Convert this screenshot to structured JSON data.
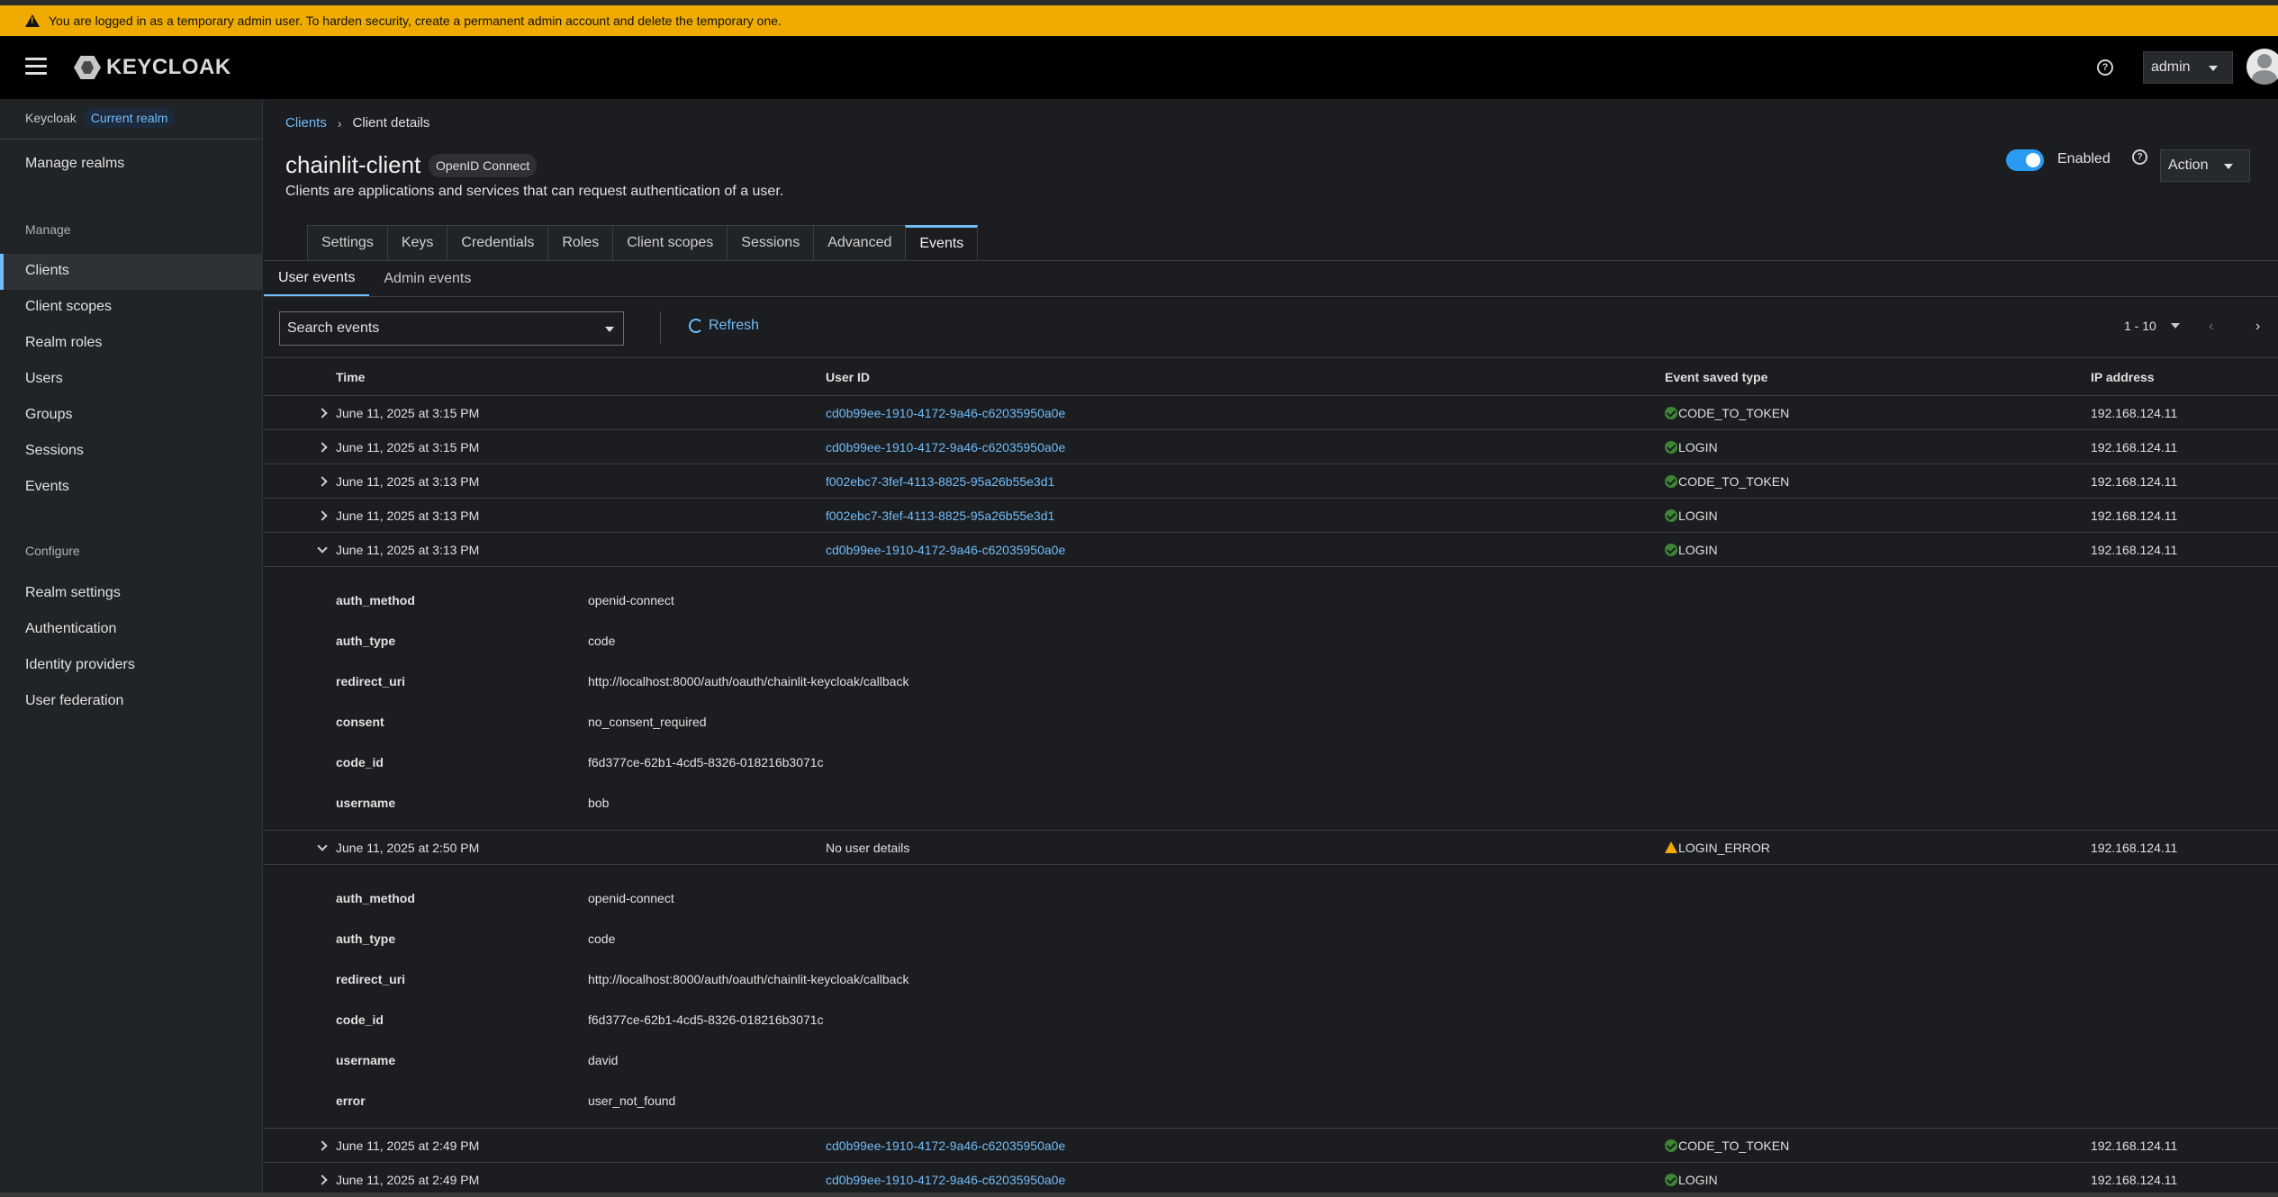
{
  "banner": {
    "text": "You are logged in as a temporary admin user. To harden security, create a permanent admin account and delete the temporary one."
  },
  "masthead": {
    "logo_text": "KEYCLOAK",
    "user": "admin"
  },
  "sidebar": {
    "realm_label": "Keycloak",
    "realm_badge": "Current realm",
    "manage_realms": "Manage realms",
    "manage_section": "Manage",
    "manage_items": [
      "Clients",
      "Client scopes",
      "Realm roles",
      "Users",
      "Groups",
      "Sessions",
      "Events"
    ],
    "configure_section": "Configure",
    "configure_items": [
      "Realm settings",
      "Authentication",
      "Identity providers",
      "User federation"
    ]
  },
  "breadcrumb": {
    "parent": "Clients",
    "current": "Client details"
  },
  "client": {
    "name": "chainlit-client",
    "protocol": "OpenID Connect",
    "description": "Clients are applications and services that can request authentication of a user.",
    "enabled_label": "Enabled",
    "action_label": "Action"
  },
  "tabs": [
    "Settings",
    "Keys",
    "Credentials",
    "Roles",
    "Client scopes",
    "Sessions",
    "Advanced",
    "Events"
  ],
  "active_tab": "Events",
  "subtabs": [
    "User events",
    "Admin events"
  ],
  "toolbar": {
    "search_placeholder": "Search events",
    "refresh_label": "Refresh",
    "pagination": "1 - 10"
  },
  "table": {
    "headers": {
      "time": "Time",
      "user_id": "User ID",
      "event_type": "Event saved type",
      "ip": "IP address"
    },
    "rows": [
      {
        "time": "June 11, 2025 at 3:15 PM",
        "user_id": "cd0b99ee-1910-4172-9a46-c62035950a0e",
        "type": "CODE_TO_TOKEN",
        "ip": "192.168.124.11"
      },
      {
        "time": "June 11, 2025 at 3:15 PM",
        "user_id": "cd0b99ee-1910-4172-9a46-c62035950a0e",
        "type": "LOGIN",
        "ip": "192.168.124.11"
      },
      {
        "time": "June 11, 2025 at 3:13 PM",
        "user_id": "f002ebc7-3fef-4113-8825-95a26b55e3d1",
        "type": "CODE_TO_TOKEN",
        "ip": "192.168.124.11"
      },
      {
        "time": "June 11, 2025 at 3:13 PM",
        "user_id": "f002ebc7-3fef-4113-8825-95a26b55e3d1",
        "type": "LOGIN",
        "ip": "192.168.124.11"
      },
      {
        "time": "June 11, 2025 at 3:13 PM",
        "user_id": "cd0b99ee-1910-4172-9a46-c62035950a0e",
        "type": "LOGIN",
        "ip": "192.168.124.11"
      },
      {
        "time": "June 11, 2025 at 2:50 PM",
        "user_id": "No user details",
        "type": "LOGIN_ERROR",
        "ip": "192.168.124.11"
      },
      {
        "time": "June 11, 2025 at 2:49 PM",
        "user_id": "cd0b99ee-1910-4172-9a46-c62035950a0e",
        "type": "CODE_TO_TOKEN",
        "ip": "192.168.124.11"
      },
      {
        "time": "June 11, 2025 at 2:49 PM",
        "user_id": "cd0b99ee-1910-4172-9a46-c62035950a0e",
        "type": "LOGIN",
        "ip": "192.168.124.11"
      }
    ],
    "details_1": [
      {
        "key": "auth_method",
        "value": "openid-connect"
      },
      {
        "key": "auth_type",
        "value": "code"
      },
      {
        "key": "redirect_uri",
        "value": "http://localhost:8000/auth/oauth/chainlit-keycloak/callback"
      },
      {
        "key": "consent",
        "value": "no_consent_required"
      },
      {
        "key": "code_id",
        "value": "f6d377ce-62b1-4cd5-8326-018216b3071c"
      },
      {
        "key": "username",
        "value": "bob"
      }
    ],
    "details_2": [
      {
        "key": "auth_method",
        "value": "openid-connect"
      },
      {
        "key": "auth_type",
        "value": "code"
      },
      {
        "key": "redirect_uri",
        "value": "http://localhost:8000/auth/oauth/chainlit-keycloak/callback"
      },
      {
        "key": "code_id",
        "value": "f6d377ce-62b1-4cd5-8326-018216b3071c"
      },
      {
        "key": "username",
        "value": "david"
      },
      {
        "key": "error",
        "value": "user_not_found"
      }
    ]
  },
  "colors": {
    "accent": "#73bcf7",
    "banner": "#f0ab00",
    "success": "#3e8635",
    "toggle": "#2b9af3"
  }
}
